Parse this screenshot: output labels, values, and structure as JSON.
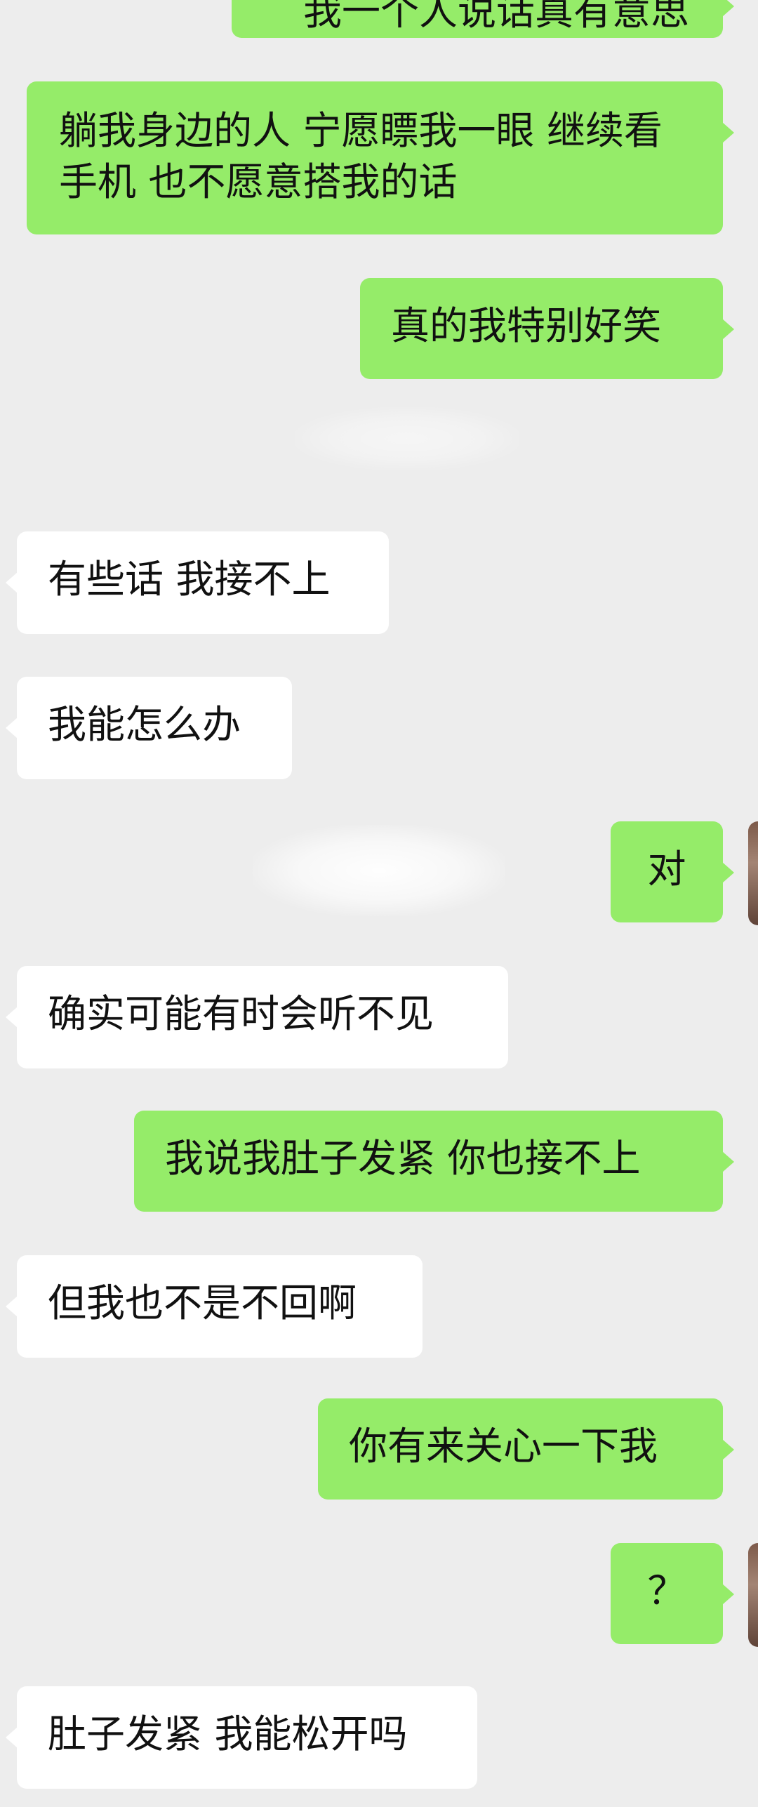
{
  "messages": [
    {
      "id": "m0",
      "side": "out",
      "text": "我一个人说话真有意思"
    },
    {
      "id": "m1",
      "side": "out",
      "text": "躺我身边的人 宁愿瞟我一眼 继续看手机 也不愿意搭我的话"
    },
    {
      "id": "m2",
      "side": "out",
      "text": "真的我特别好笑"
    },
    {
      "id": "m3",
      "side": "in",
      "text": "有些话 我接不上"
    },
    {
      "id": "m4",
      "side": "in",
      "text": "我能怎么办"
    },
    {
      "id": "m5",
      "side": "out",
      "text": "对"
    },
    {
      "id": "m6",
      "side": "in",
      "text": "确实可能有时会听不见"
    },
    {
      "id": "m7",
      "side": "out",
      "text": "我说我肚子发紧 你也接不上"
    },
    {
      "id": "m8",
      "side": "in",
      "text": "但我也不是不回啊"
    },
    {
      "id": "m9",
      "side": "out",
      "text": "你有来关心一下我"
    },
    {
      "id": "m10",
      "side": "out",
      "text": "？"
    },
    {
      "id": "m11",
      "side": "in",
      "text": "肚子发紧 我能松开吗"
    }
  ],
  "colors": {
    "background": "#EDEDED",
    "outgoing_bubble": "#95EC69",
    "incoming_bubble": "#FFFFFF",
    "text": "#111111"
  }
}
